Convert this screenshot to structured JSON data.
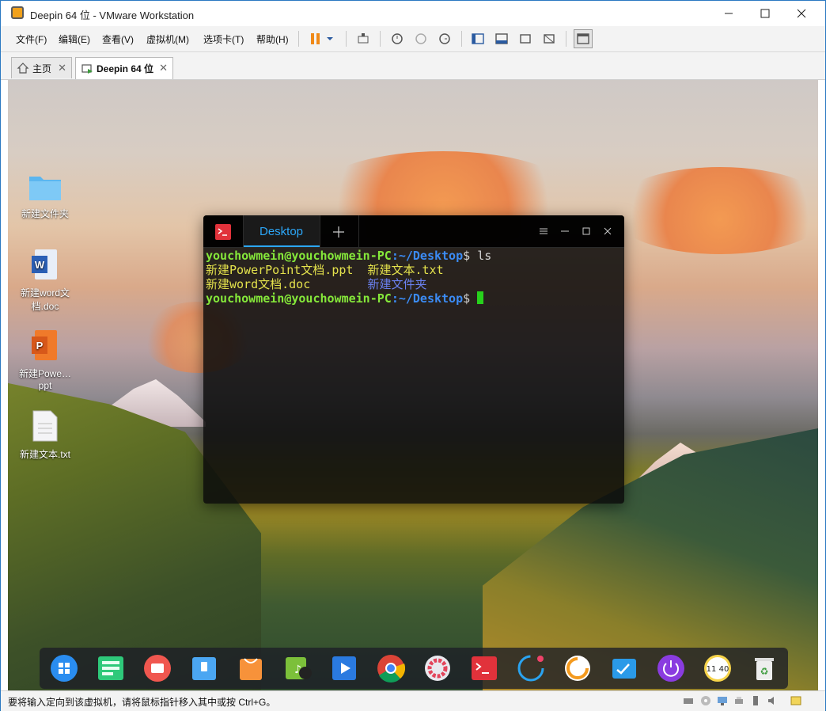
{
  "window": {
    "title": "Deepin 64 位 - VMware Workstation"
  },
  "menu": [
    "文件(F)",
    "编辑(E)",
    "查看(V)",
    "虚拟机(M)",
    "选项卡(T)",
    "帮助(H)"
  ],
  "tabs": [
    {
      "label": "主页",
      "icon": "home-icon"
    },
    {
      "label": "Deepin 64 位",
      "icon": "vm-icon",
      "active": true
    }
  ],
  "desktop_icons": [
    {
      "label": "新建文件夹",
      "icon": "folder-icon"
    },
    {
      "label": "新建word文档.doc",
      "icon": "word-icon"
    },
    {
      "label": "新建Powe…ppt",
      "icon": "powerpoint-icon"
    },
    {
      "label": "新建文本.txt",
      "icon": "text-file-icon"
    }
  ],
  "terminal": {
    "tab_label": "Desktop",
    "prompt_user": "youchowmein@youchowmein-PC",
    "prompt_path": ":~/Desktop",
    "command": "ls",
    "files": [
      "新建PowerPoint文档.ppt",
      "新建文本.txt",
      "新建word文档.doc"
    ],
    "dir": "新建文件夹"
  },
  "dock": [
    "launcher-icon",
    "multitask-icon",
    "screen-recorder-icon",
    "file-manager-icon",
    "app-store-icon",
    "music-icon",
    "video-icon",
    "chrome-icon",
    "settings-icon",
    "terminal-icon",
    "browser-icon",
    "screenshot-icon",
    "system-monitor-icon",
    "power-icon",
    "clock-icon",
    "trash-icon"
  ],
  "dock_clock": "11 40",
  "status": {
    "message": "要将输入定向到该虚拟机，请将鼠标指针移入其中或按 Ctrl+G。"
  },
  "colors": {
    "accent": "#2ca7f8",
    "prompt_green": "#85e83a",
    "prompt_blue": "#3b8bf5"
  }
}
